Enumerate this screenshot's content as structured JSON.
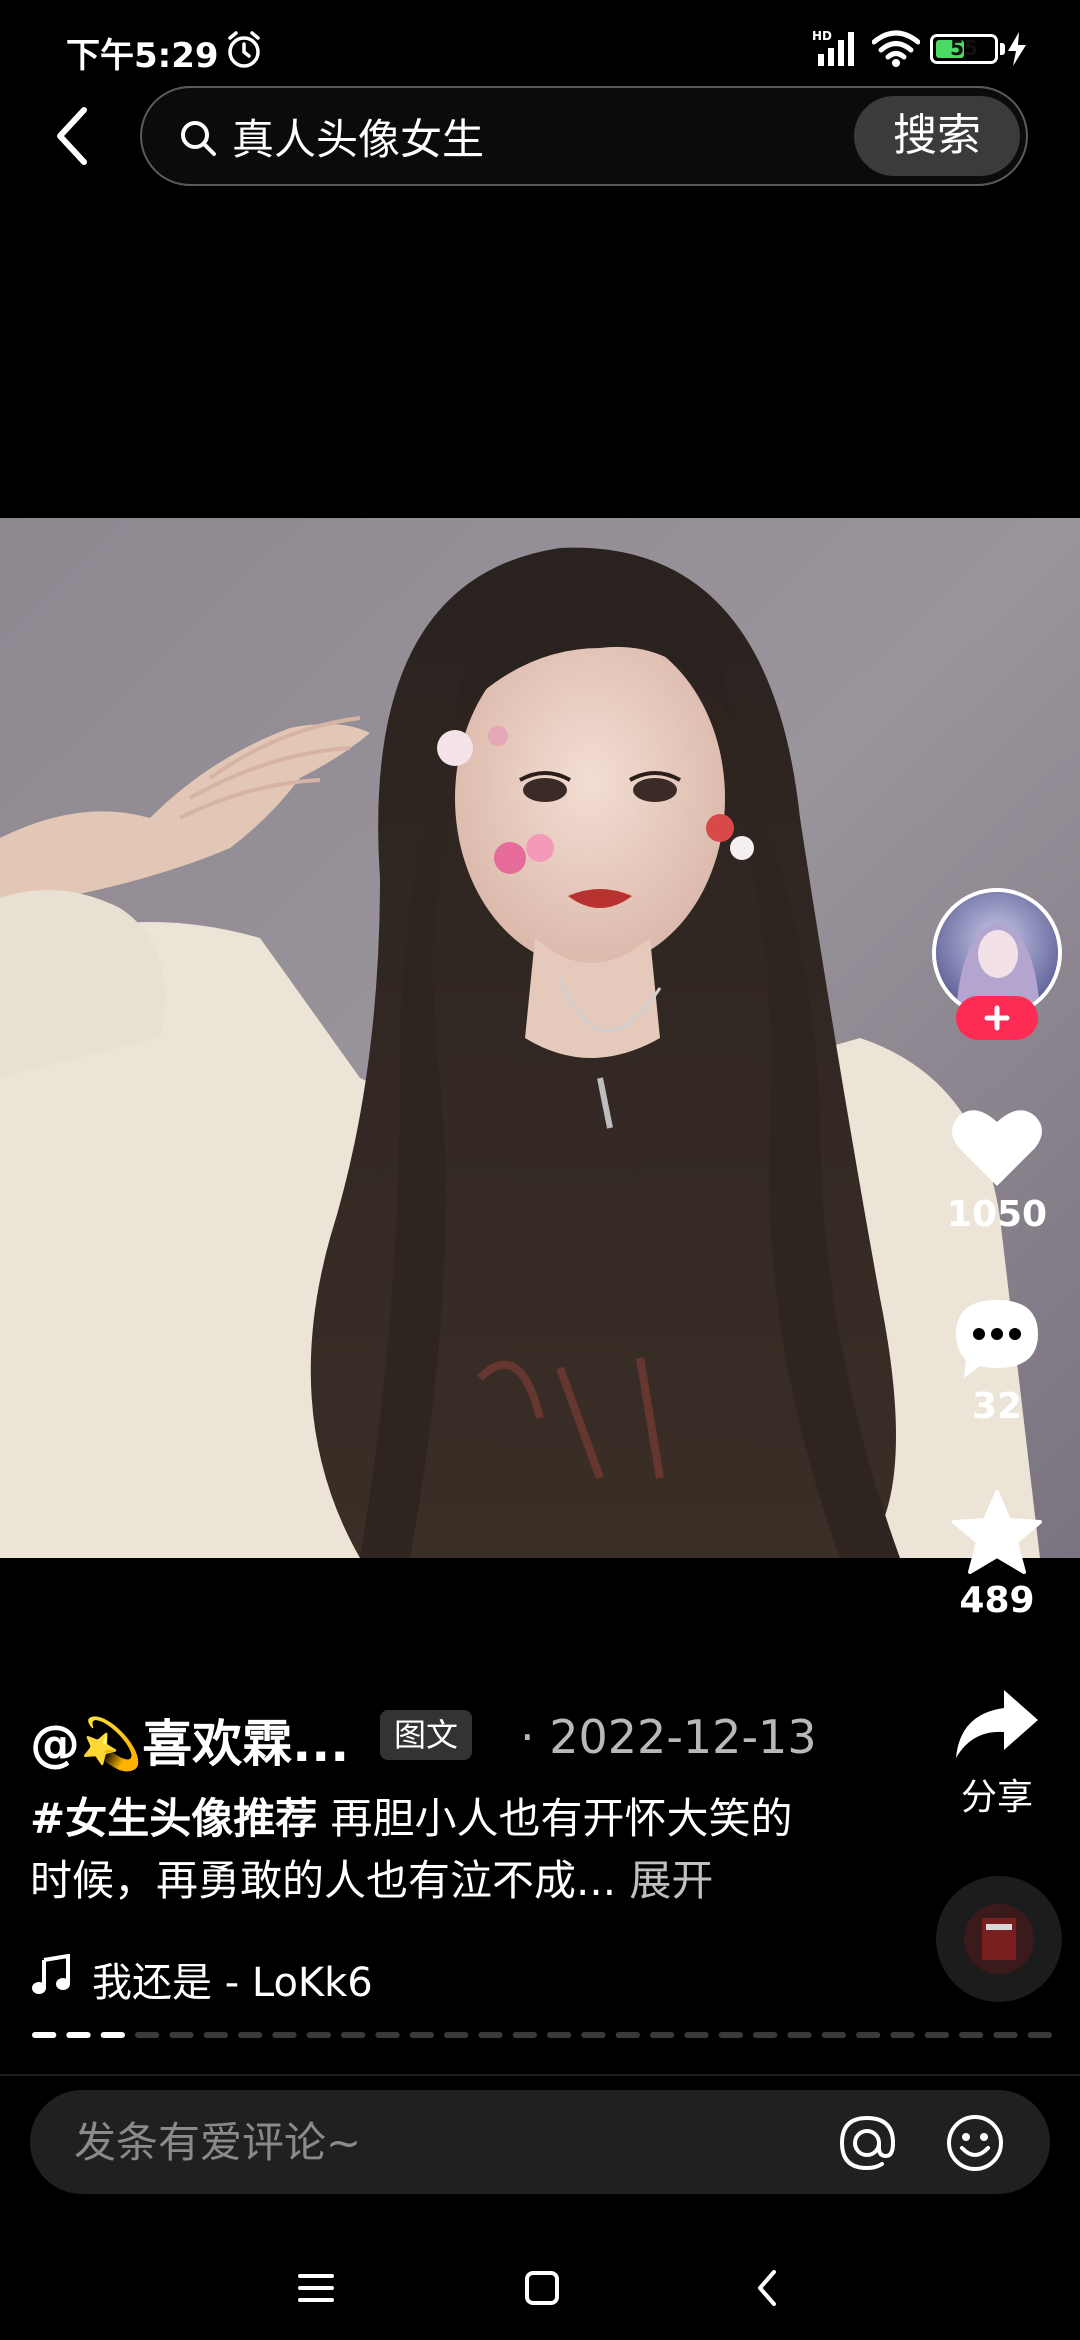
{
  "status_bar": {
    "time": "下午5:29",
    "battery": "55",
    "battery_level": 0.55,
    "network": "HD"
  },
  "search": {
    "query": "真人头像女生",
    "button_label": "搜索"
  },
  "post": {
    "author": "@💫喜欢霖...",
    "type_badge": "图文",
    "separator": "·",
    "date": "2022-12-13",
    "hashtag": "#女生头像推荐",
    "caption_text": " 再胆小人也有开怀大笑的时候，再勇敢的人也有泣不成... ",
    "expand_label": "展开",
    "music": "我还是 - LoKk6",
    "image_pages": 30,
    "current_page": 3
  },
  "actions": {
    "likes": "1050",
    "comments": "32",
    "favorites": "489",
    "share_label": "分享"
  },
  "comment": {
    "placeholder": "发条有爱评论~"
  },
  "colors": {
    "accent": "#fe2c55",
    "background": "#000000",
    "battery_fill": "#4cd964"
  },
  "icons": [
    "back-icon",
    "search-icon",
    "heart-icon",
    "comment-icon",
    "star-icon",
    "share-icon",
    "music-note-icon",
    "at-icon",
    "emoji-icon",
    "menu-icon",
    "home-icon",
    "nav-back-icon"
  ]
}
